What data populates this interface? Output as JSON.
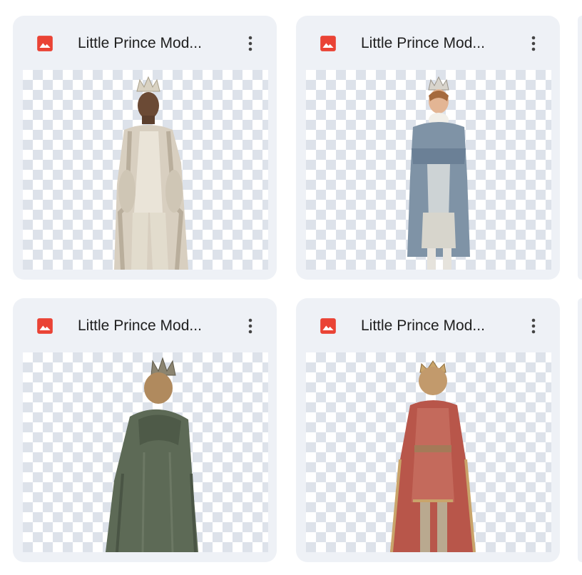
{
  "files": [
    {
      "name": "Little Prince Mod...",
      "type_icon": "image-icon",
      "thumbnail": "boy in crown and fur coat, front view"
    },
    {
      "name": "Little Prince Mod...",
      "type_icon": "image-icon",
      "thumbnail": "boy in crown and blue frock coat, arms crossed"
    },
    {
      "name": "Little Prince Mod...",
      "type_icon": "image-icon",
      "thumbnail": "boy in crown and green cloak, back view"
    },
    {
      "name": "Little Prince Mod...",
      "type_icon": "image-icon",
      "thumbnail": "boy in crown and red royal robe, back view"
    }
  ],
  "colors": {
    "card_bg": "#eef1f6",
    "image_icon": "#ea4335",
    "text": "#1f1f1f",
    "checker": "#dde2ea"
  }
}
